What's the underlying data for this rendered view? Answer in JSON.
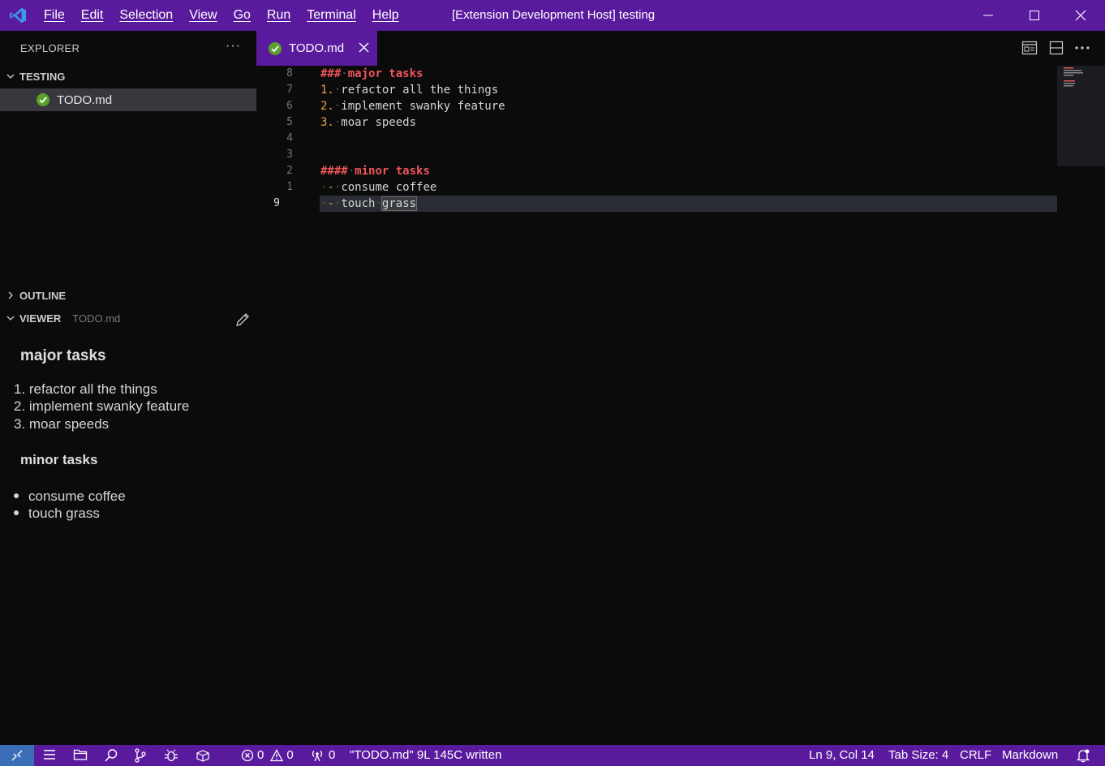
{
  "titlebar": {
    "menu": [
      "File",
      "Edit",
      "Selection",
      "View",
      "Go",
      "Run",
      "Terminal",
      "Help"
    ],
    "title": "[Extension Development Host] testing"
  },
  "sidebar": {
    "header": "EXPLORER",
    "more": "···",
    "folder": "TESTING",
    "file": "TODO.md",
    "outline": "OUTLINE",
    "viewer": "VIEWER",
    "viewer_file": "TODO.md"
  },
  "preview": {
    "h_major": "major tasks",
    "major_items": [
      "1. refactor all the things",
      "2. implement swanky feature",
      "3. moar speeds"
    ],
    "h_minor": "minor tasks",
    "minor_items": [
      "consume coffee",
      "touch grass"
    ]
  },
  "tab": {
    "label": "TODO.md"
  },
  "editor": {
    "line_numbers": [
      "8",
      "7",
      "6",
      "5",
      "4",
      "3",
      "2",
      "1",
      "9"
    ],
    "h_major_hash": "###",
    "h_major_text": "major tasks",
    "item1_num": "1.",
    "item1_text": "refactor all the things",
    "item2_num": "2.",
    "item2_text": "implement swanky feature",
    "item3_num": "3.",
    "item3_text": "moar speeds",
    "h_minor_hash": "####",
    "h_minor_text": "minor tasks",
    "dash": "-",
    "minor1_text": "consume coffee",
    "minor2_a": "touch",
    "minor2_b": "grass"
  },
  "statusbar": {
    "errors": "0",
    "warnings": "0",
    "ports": "0",
    "message": "\"TODO.md\" 9L 145C written",
    "position": "Ln 9, Col 14",
    "tabsize": "Tab Size: 4",
    "eol": "CRLF",
    "language": "Markdown"
  },
  "colors": {
    "accent": "#5a1a9e",
    "remote": "#3a6fb8",
    "heading": "#f0555b",
    "list_number": "#e8a33d",
    "check": "#5aa02c"
  }
}
